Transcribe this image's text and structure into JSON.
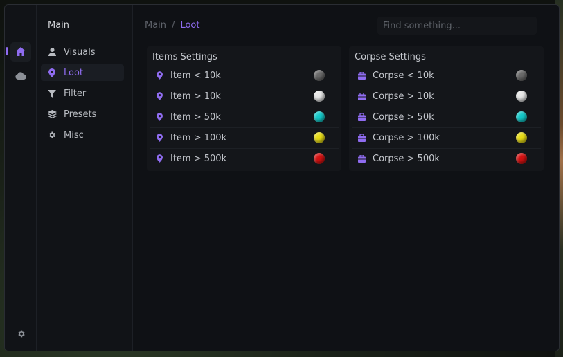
{
  "colors": {
    "accent": "#8f6cf0",
    "swatches": [
      "#6a6a6a",
      "#e8e8e8",
      "#13c9c9",
      "#e8dc15",
      "#d41111"
    ]
  },
  "rail": {
    "items": [
      {
        "icon": "home-icon",
        "active": true
      },
      {
        "icon": "cloud-icon",
        "active": false
      }
    ],
    "settings_icon": "gear-icon"
  },
  "menu": {
    "title": "Main",
    "items": [
      {
        "label": "Visuals",
        "icon": "user-icon",
        "active": false
      },
      {
        "label": "Loot",
        "icon": "map-pin-icon",
        "active": true
      },
      {
        "label": "Filter",
        "icon": "filter-icon",
        "active": false
      },
      {
        "label": "Presets",
        "icon": "layers-icon",
        "active": false
      },
      {
        "label": "Misc",
        "icon": "gear-icon",
        "active": false
      }
    ]
  },
  "breadcrumb": {
    "root": "Main",
    "separator": "/",
    "current": "Loot"
  },
  "search": {
    "placeholder": "Find something...",
    "value": ""
  },
  "panels": {
    "items": {
      "title": "Items Settings",
      "icon": "map-pin-icon",
      "rows": [
        {
          "label": "Item < 10k",
          "color": "#6a6a6a"
        },
        {
          "label": "Item > 10k",
          "color": "#e8e8e8"
        },
        {
          "label": "Item > 50k",
          "color": "#13c9c9"
        },
        {
          "label": "Item > 100k",
          "color": "#e8dc15"
        },
        {
          "label": "Item > 500k",
          "color": "#d41111"
        }
      ]
    },
    "corpse": {
      "title": "Corpse Settings",
      "icon": "briefcase-icon",
      "rows": [
        {
          "label": "Corpse < 10k",
          "color": "#6a6a6a"
        },
        {
          "label": "Corpse > 10k",
          "color": "#e8e8e8"
        },
        {
          "label": "Corpse > 50k",
          "color": "#13c9c9"
        },
        {
          "label": "Corpse > 100k",
          "color": "#e8dc15"
        },
        {
          "label": "Corpse > 500k",
          "color": "#d41111"
        }
      ]
    }
  }
}
